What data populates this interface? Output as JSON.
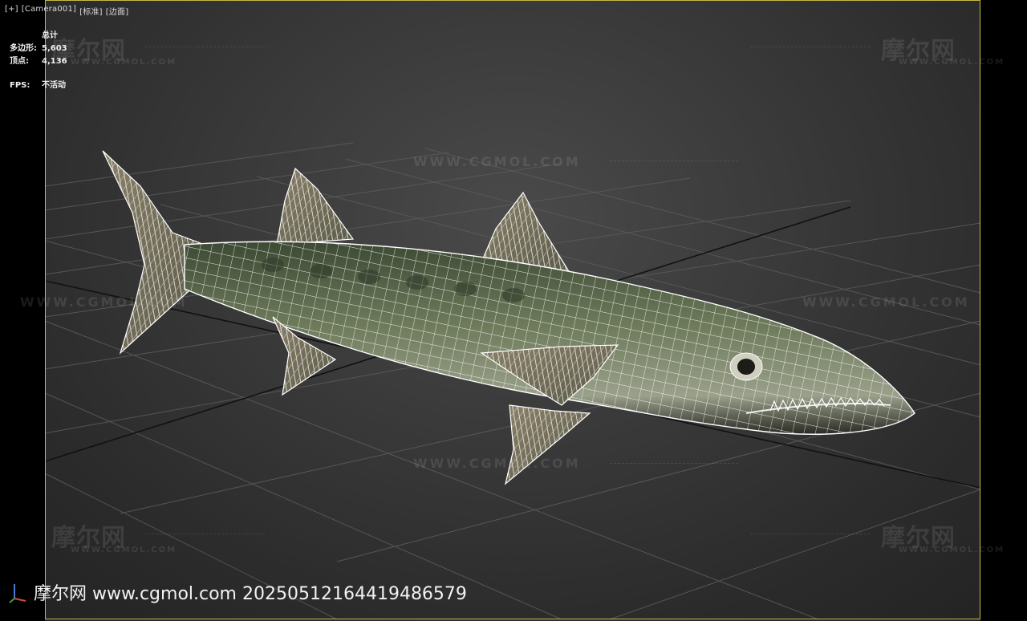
{
  "viewport_menu": {
    "plus": "[+]",
    "camera": "[Camera001]",
    "shading": "[标准]",
    "style": "[边面]"
  },
  "stats": {
    "title": "总计",
    "polygons_label": "多边形:",
    "polygons_value": "5,603",
    "vertices_label": "顶点:",
    "vertices_value": "4,136",
    "fps_label": "FPS:",
    "fps_value": "不活动"
  },
  "watermark": {
    "cn": "摩尔网",
    "en": "WWW.CGMOL.COM",
    "url": "WWW.CGMOL.COM"
  },
  "footer": {
    "text": "摩尔网 www.cgmol.com 20250512164419486579"
  },
  "colors": {
    "safe_frame": "#c8b848",
    "grid": "#5a5a5a",
    "fish_body": "#5e6e4e",
    "wireframe": "#ffffff"
  }
}
